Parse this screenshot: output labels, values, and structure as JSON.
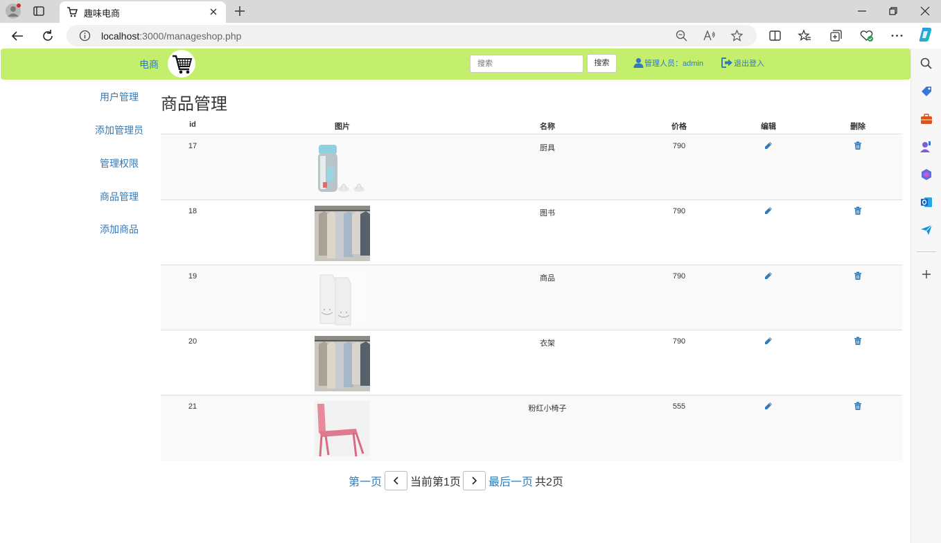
{
  "browser": {
    "tab_title": "趣味电商",
    "url_host": "localhost",
    "url_rest": ":3000/manageshop.php"
  },
  "header": {
    "brand": "电商",
    "search_placeholder": "搜索",
    "search_button": "搜索",
    "admin_label": "管理人员：admin",
    "logout_label": "退出登入",
    "bg_color": "#c3ef6c",
    "link_color": "#337ab7"
  },
  "sidebar": {
    "items": [
      {
        "label": "用户管理"
      },
      {
        "label": "添加管理员"
      },
      {
        "label": "管理权限"
      },
      {
        "label": "商品管理"
      },
      {
        "label": "添加商品"
      }
    ]
  },
  "main": {
    "title": "商品管理",
    "columns": [
      "id",
      "图片",
      "名称",
      "价格",
      "编辑",
      "删除"
    ],
    "rows": [
      {
        "id": "17",
        "name": "厨具",
        "price": "790",
        "image": "thermos-bottle"
      },
      {
        "id": "18",
        "name": "图书",
        "price": "790",
        "image": "hanging-shirts"
      },
      {
        "id": "19",
        "name": "商品",
        "price": "790",
        "image": "white-file-boxes"
      },
      {
        "id": "20",
        "name": "衣架",
        "price": "790",
        "image": "hanging-shirts"
      },
      {
        "id": "21",
        "name": "粉红小椅子",
        "price": "555",
        "image": "pink-chair"
      }
    ]
  },
  "pager": {
    "first": "第一页",
    "current": "当前第1页",
    "last": "最后一页",
    "total": "共2页"
  }
}
